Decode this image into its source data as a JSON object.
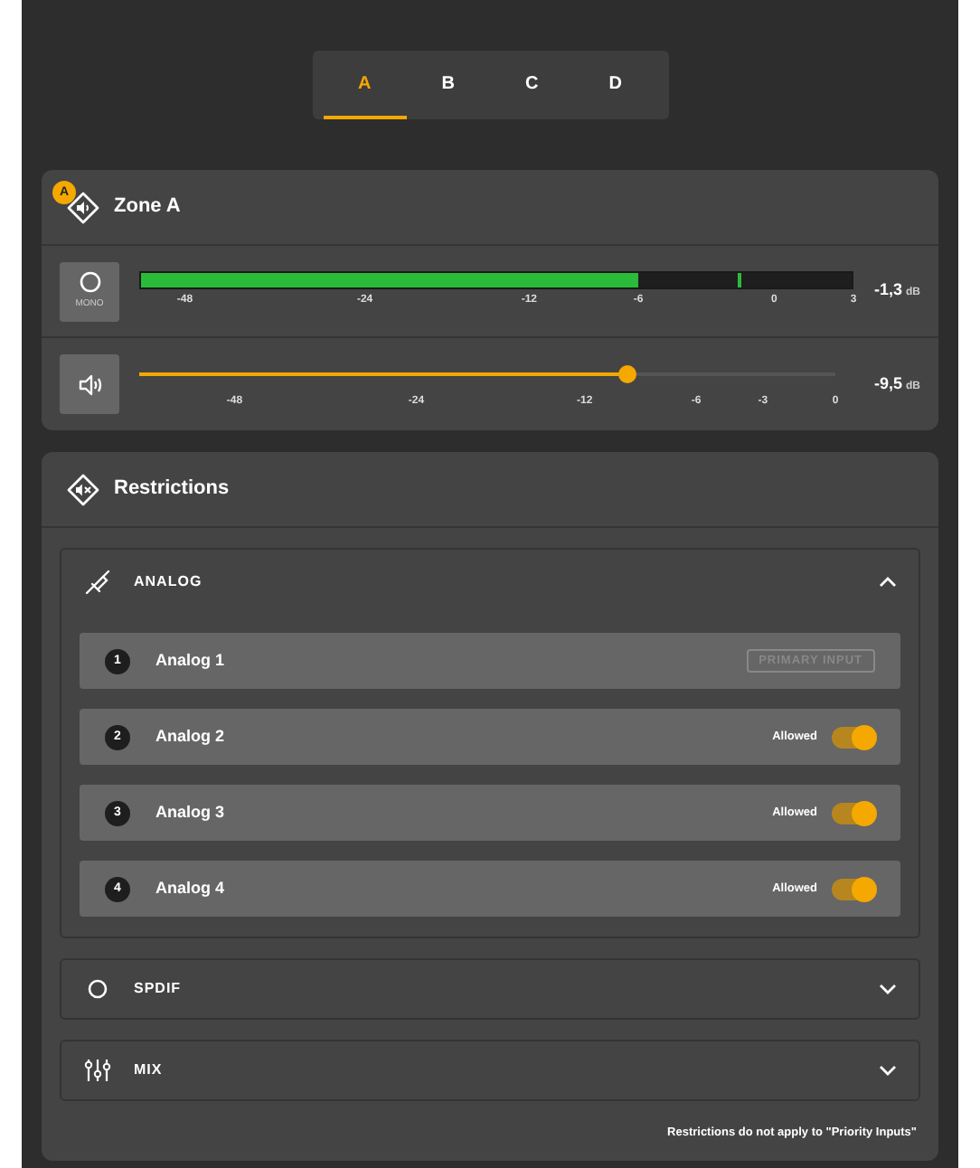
{
  "tabs": [
    {
      "label": "A",
      "selected": true
    },
    {
      "label": "B",
      "selected": false
    },
    {
      "label": "C",
      "selected": false
    },
    {
      "label": "D",
      "selected": false
    }
  ],
  "zone": {
    "badge": "A",
    "title": "Zone A",
    "meter": {
      "button_label": "MONO",
      "level": 0.7,
      "peak": {
        "level": 0.84
      },
      "reading": "-1,3",
      "unit": "dB",
      "ticks": [
        "-48",
        "-24",
        "-12",
        "-6",
        "0",
        "3"
      ]
    },
    "volume": {
      "level": 0.7,
      "reading": "-9,5",
      "unit": "dB",
      "ticks": [
        "-48",
        "-24",
        "-12",
        "-6",
        "-3",
        "0"
      ]
    }
  },
  "restrictions": {
    "title": "Restrictions",
    "sections": [
      {
        "kind": "analog",
        "title": "ANALOG",
        "expanded": true,
        "inputs": [
          {
            "number": "1",
            "name": "Analog 1",
            "kind": "primary",
            "tag": "PRIMARY INPUT"
          },
          {
            "number": "2",
            "name": "Analog 2",
            "kind": "toggle",
            "label": "Allowed",
            "on": true
          },
          {
            "number": "3",
            "name": "Analog 3",
            "kind": "toggle",
            "label": "Allowed",
            "on": true
          },
          {
            "number": "4",
            "name": "Analog 4",
            "kind": "toggle",
            "label": "Allowed",
            "on": true
          }
        ]
      },
      {
        "kind": "spdif",
        "title": "SPDIF",
        "expanded": false
      },
      {
        "kind": "mix",
        "title": "MIX",
        "expanded": false
      }
    ],
    "note": "Restrictions do not apply to \"Priority Inputs\""
  }
}
